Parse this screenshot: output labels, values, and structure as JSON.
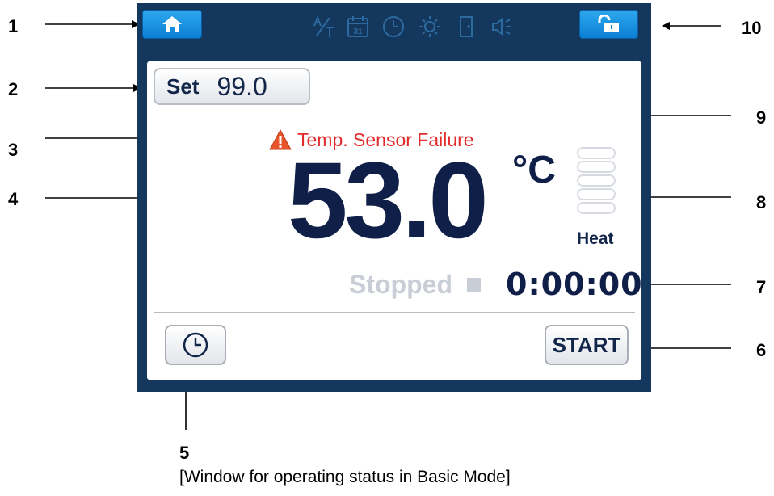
{
  "device": {
    "topbar": {
      "home_icon": "home-icon",
      "status_icons": [
        "auto-tune-icon",
        "calendar-icon",
        "clock-icon",
        "light-icon",
        "door-icon",
        "buzzer-icon"
      ],
      "calendar_day": "31",
      "lock_icon": "unlock-icon",
      "accent_color": "#1a94e4",
      "bar_color": "#14375d"
    },
    "setpoint": {
      "label": "Set",
      "value": "99.0"
    },
    "alert": {
      "icon": "warning-icon",
      "text": "Temp. Sensor Failure",
      "color": "#e22b2b"
    },
    "temperature": {
      "value": "53.0",
      "unit": "°C"
    },
    "heat": {
      "label": "Heat",
      "level_bars": 5,
      "active_bars": 0
    },
    "run": {
      "status": "Stopped",
      "timer": "0:00:00"
    },
    "buttons": {
      "timer_icon": "clock-icon",
      "start_label": "START"
    }
  },
  "callouts": {
    "1": "1",
    "2": "2",
    "3": "3",
    "4": "4",
    "5": "5",
    "6": "6",
    "7": "7",
    "8": "8",
    "9": "9",
    "10": "10"
  },
  "caption": "[Window for operating status in Basic Mode]"
}
